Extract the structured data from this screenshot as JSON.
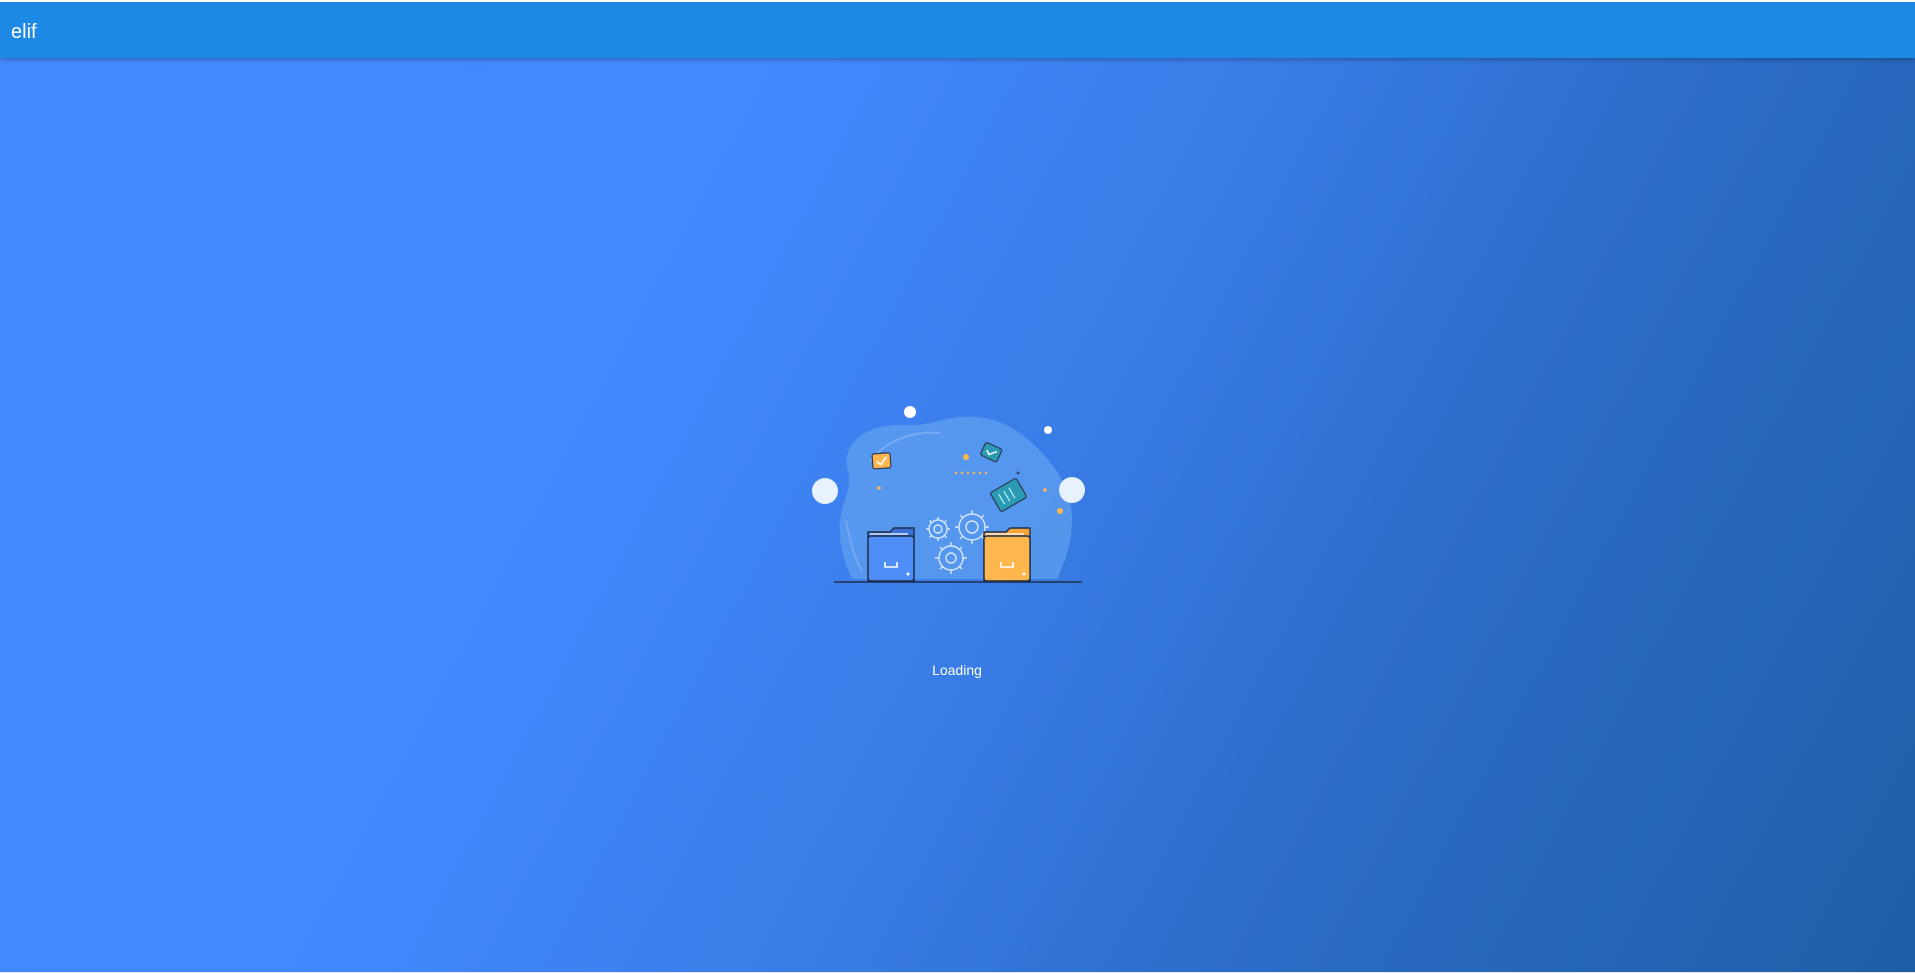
{
  "app_bar": {
    "title": "elif"
  },
  "loading": {
    "illustration_icon": "folders-gears-illustration",
    "text": "Loading"
  },
  "colors": {
    "app_bar": "#1e88e5",
    "background_start": "#428aff",
    "background_end": "#1d5fa6",
    "folder_blue": "#4f8ef7",
    "folder_orange": "#ffb74d",
    "text": "#ffffff"
  }
}
